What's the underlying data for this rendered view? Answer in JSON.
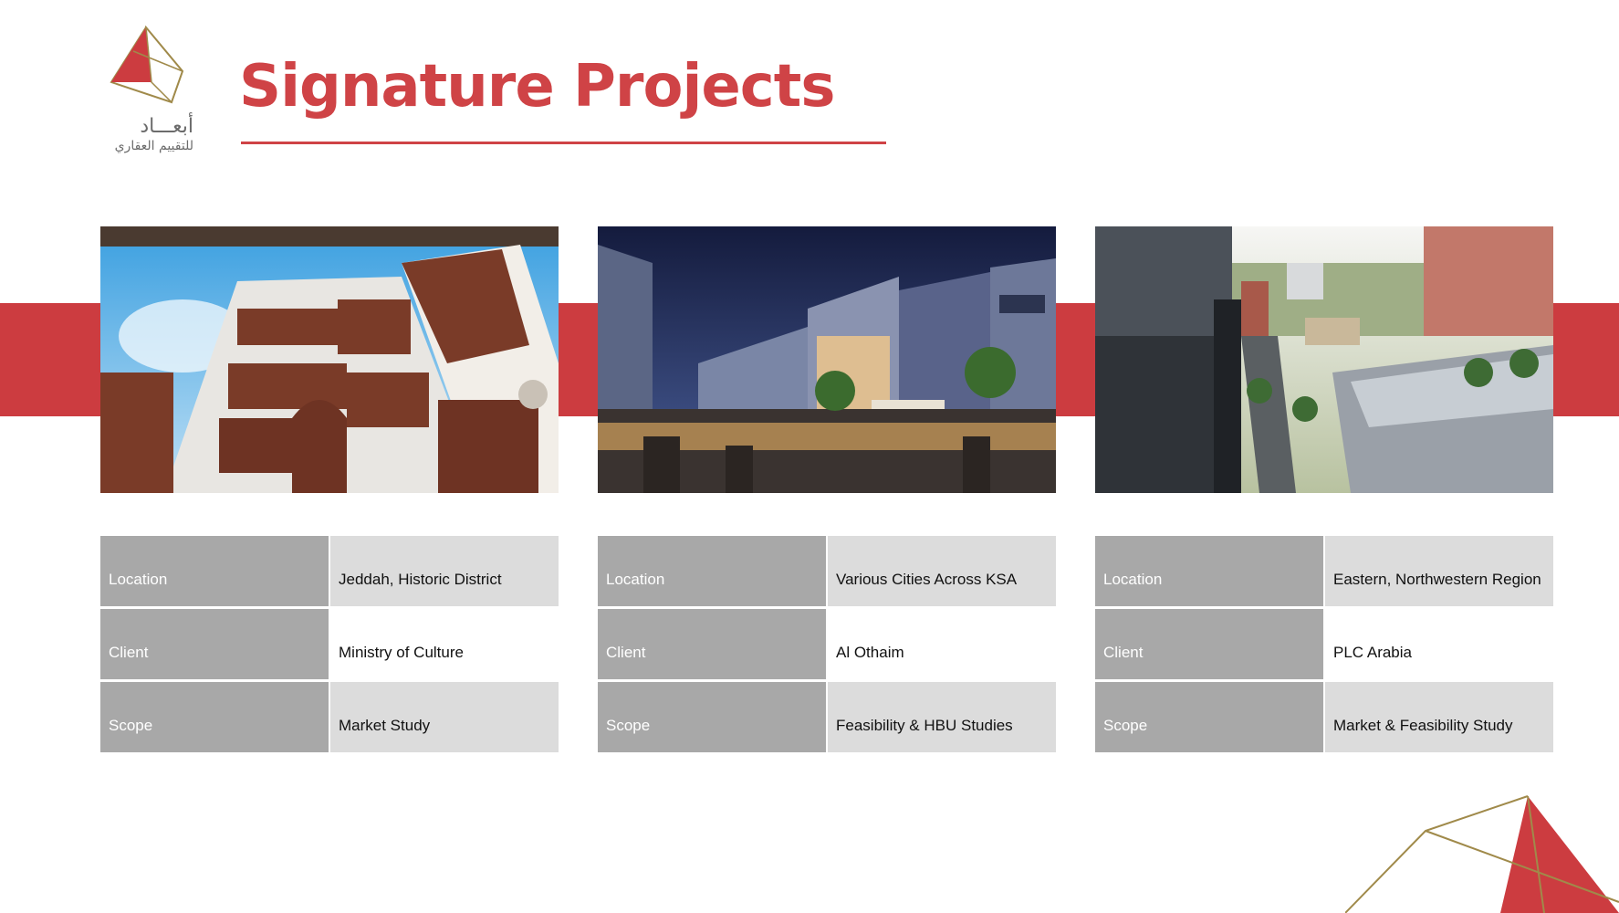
{
  "header": {
    "title": "Signature Projects",
    "logo_arabic_name": "أبعـــاد",
    "logo_arabic_tagline": "للتقييم العقاري"
  },
  "colors": {
    "accent": "#cc3c40",
    "gold": "#a08a4a",
    "label_bg": "#a8a8a8",
    "value_bg": "#dcdcdc"
  },
  "projects": [
    {
      "image": "historic-jeddah-building-photo",
      "rows": [
        {
          "label": "Location",
          "value": "Jeddah, Historic District"
        },
        {
          "label": "Client",
          "value": "Ministry of Culture"
        },
        {
          "label": "Scope",
          "value": "Market Study"
        }
      ]
    },
    {
      "image": "retail-plaza-night-rendering",
      "rows": [
        {
          "label": "Location",
          "value": "Various Cities Across KSA"
        },
        {
          "label": "Client",
          "value": "Al Othaim"
        },
        {
          "label": "Scope",
          "value": "Feasibility & HBU Studies"
        }
      ]
    },
    {
      "image": "mixed-use-district-aerial-rendering",
      "rows": [
        {
          "label": "Location",
          "value": "Eastern, Northwestern Region"
        },
        {
          "label": "Client",
          "value": "PLC Arabia"
        },
        {
          "label": "Scope",
          "value": "Market & Feasibility Study"
        }
      ]
    }
  ]
}
